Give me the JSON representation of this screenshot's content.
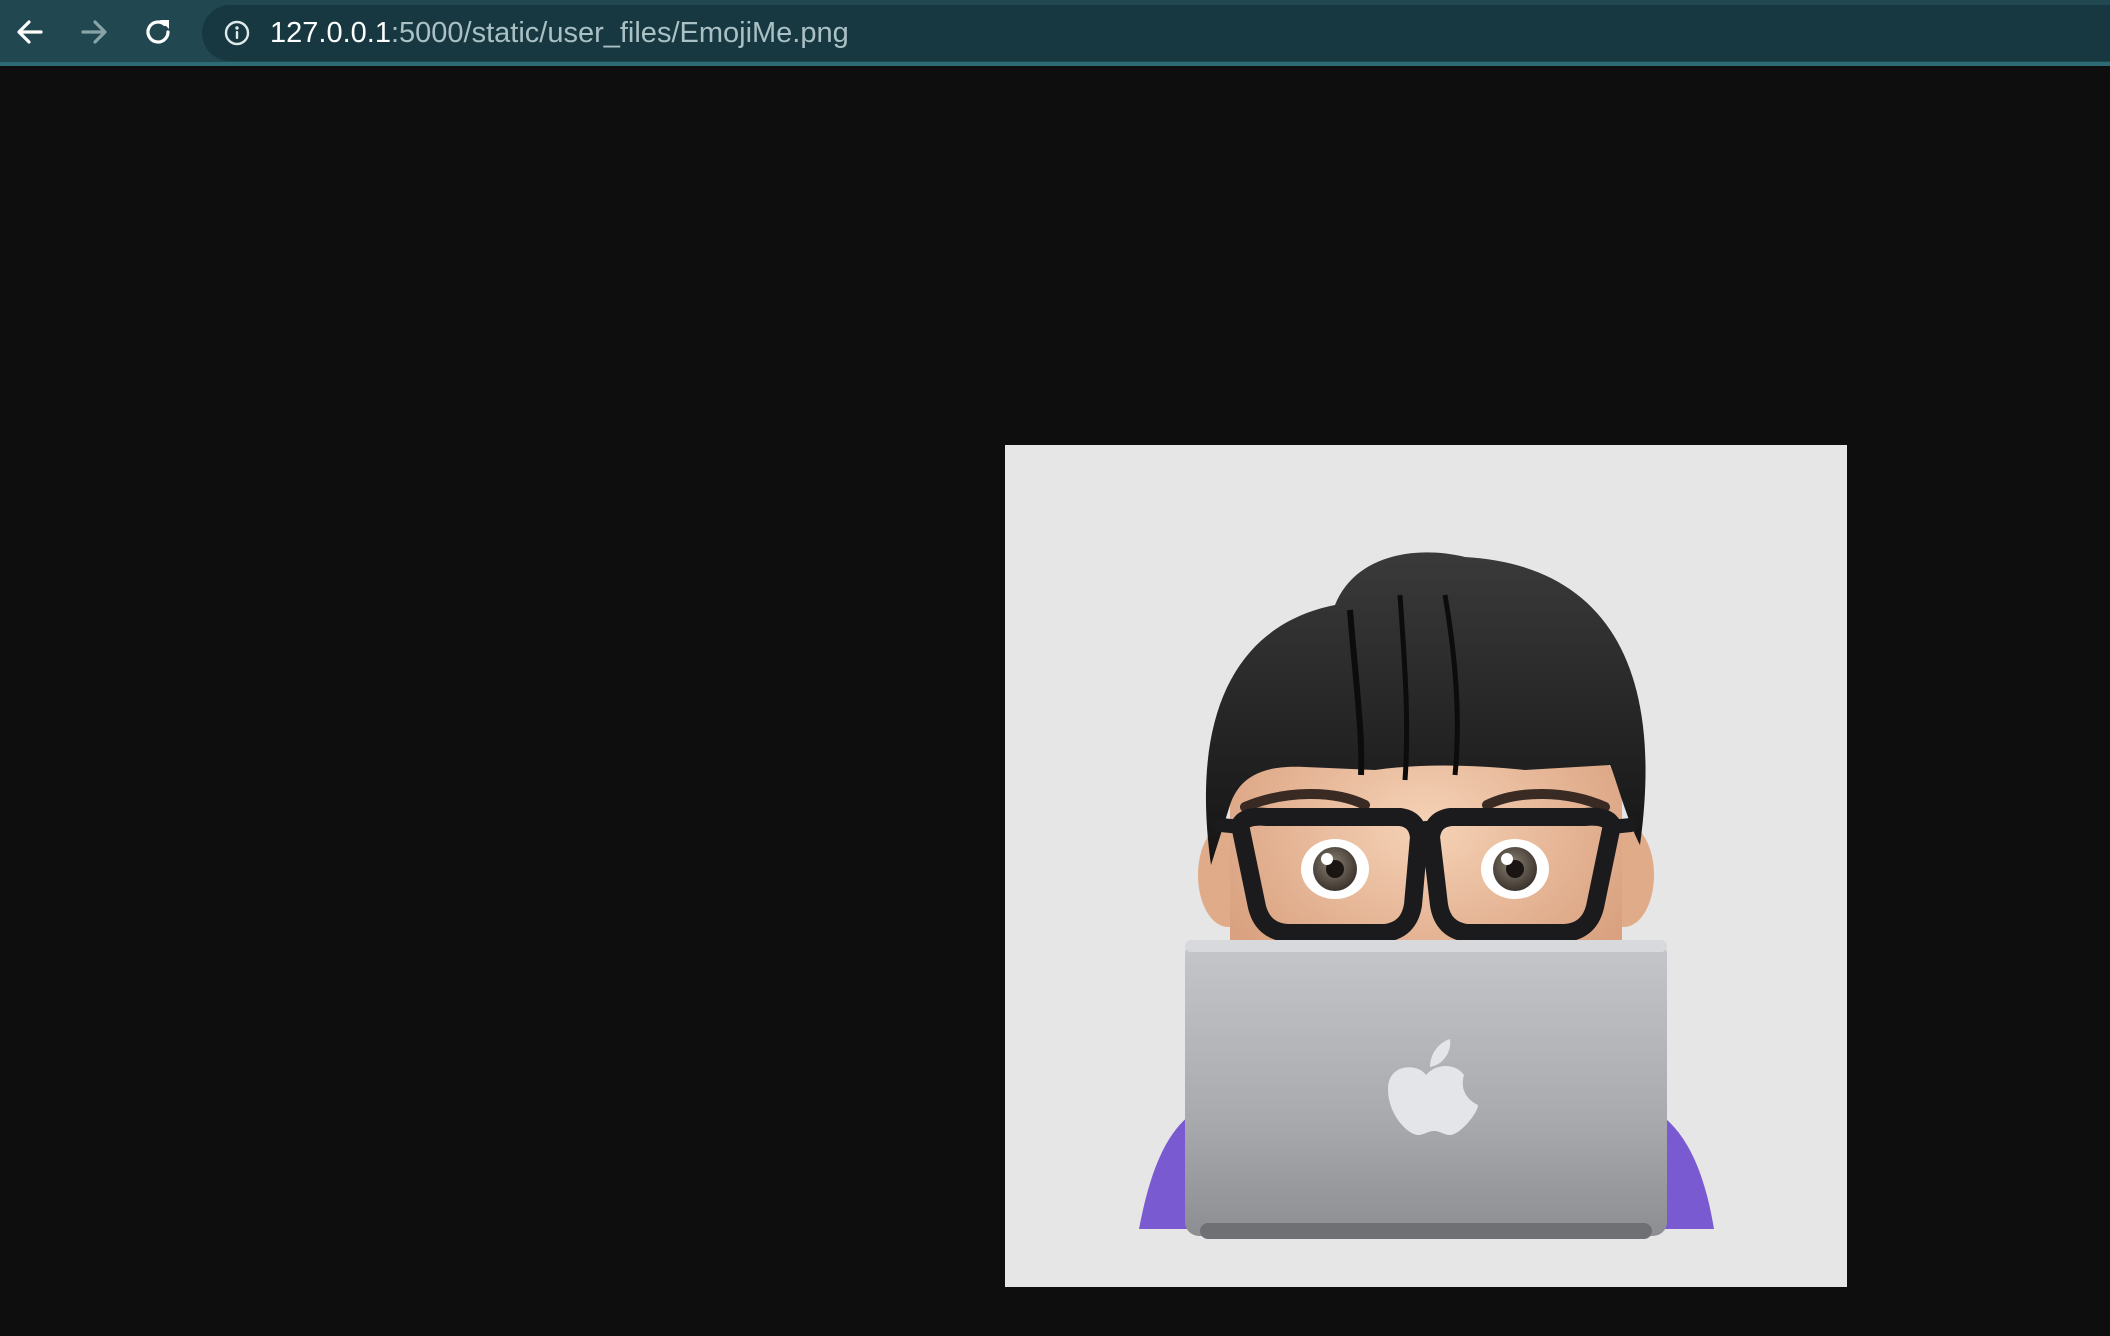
{
  "browser": {
    "url_host": "127.0.0.1",
    "url_path": ":5000/static/user_files/EmojiMe.png",
    "icons": {
      "back": "arrow-left-icon",
      "forward": "arrow-right-icon",
      "reload": "reload-icon",
      "info": "info-circle-icon"
    },
    "colors": {
      "toolbar": "#214850",
      "omnibox": "#173840",
      "host_text": "#ffffff",
      "path_text": "#a9c0c4"
    }
  },
  "viewer": {
    "background": "#0e0e0f",
    "image": {
      "description_icon": "memoji-laptop-image",
      "background": "#e6e6e6"
    }
  }
}
